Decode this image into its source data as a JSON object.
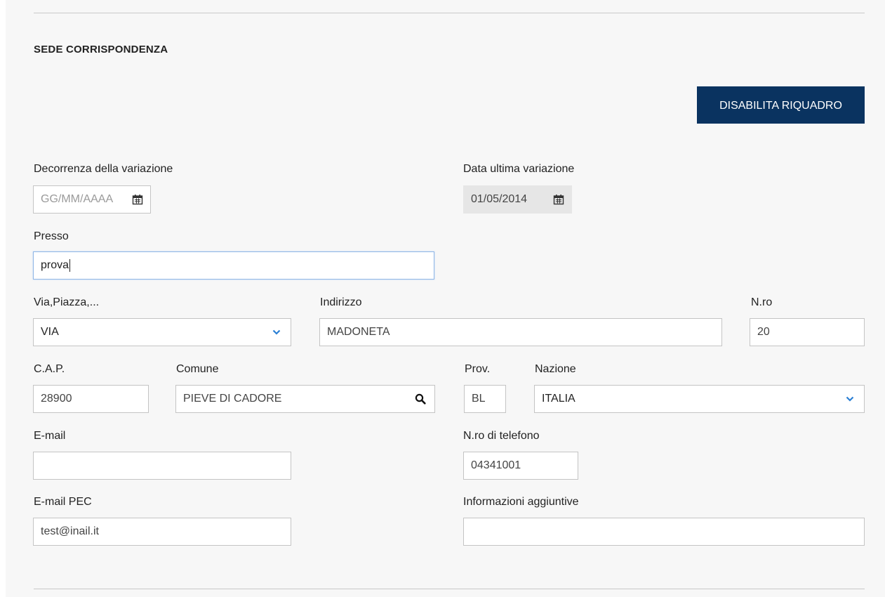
{
  "section": {
    "title": "SEDE CORRISPONDENZA",
    "disable_button_label": "DISABILITA RIQUADRO"
  },
  "fields": {
    "decorrenza": {
      "label": "Decorrenza della variazione",
      "placeholder": "GG/MM/AAAA",
      "value": "",
      "icon": "calendar-icon"
    },
    "data_ultima": {
      "label": "Data ultima variazione",
      "value": "01/05/2014",
      "icon": "calendar-icon",
      "disabled": true
    },
    "presso": {
      "label": "Presso",
      "value": "prova"
    },
    "via_piazza": {
      "label": "Via,Piazza,...",
      "value": "VIA",
      "icon": "chevron-down-icon"
    },
    "indirizzo": {
      "label": "Indirizzo",
      "value": "MADONETA"
    },
    "numero": {
      "label": "N.ro",
      "value": "20"
    },
    "cap": {
      "label": "C.A.P.",
      "value": "28900"
    },
    "comune": {
      "label": "Comune",
      "value": "PIEVE DI CADORE",
      "icon": "search-icon"
    },
    "prov": {
      "label": "Prov.",
      "value": "BL"
    },
    "nazione": {
      "label": "Nazione",
      "value": "ITALIA",
      "icon": "chevron-down-icon"
    },
    "email": {
      "label": "E-mail",
      "value": ""
    },
    "telefono": {
      "label": "N.ro di telefono",
      "value": "04341001"
    },
    "email_pec": {
      "label": "E-mail PEC",
      "value": "test@inail.it"
    },
    "info_aggiuntive": {
      "label": "Informazioni aggiuntive",
      "value": ""
    }
  },
  "colors": {
    "button_bg": "#0a3360",
    "chevron": "#2a7fd4",
    "panel_bg": "#f7f7f7"
  }
}
